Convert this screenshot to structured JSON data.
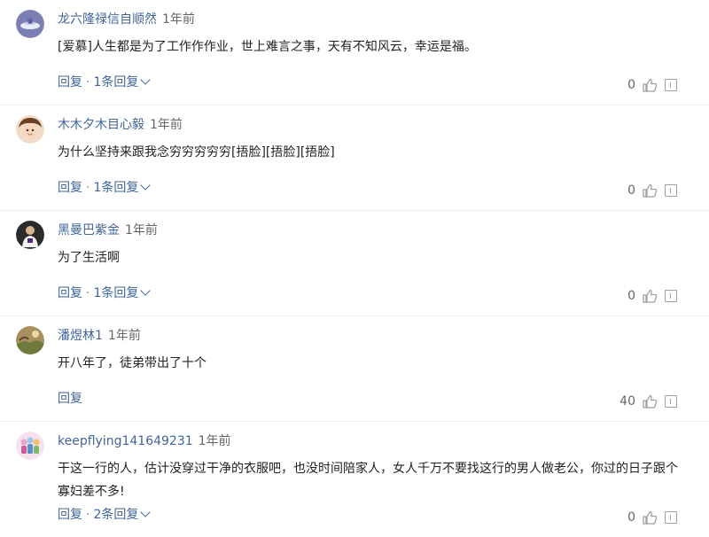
{
  "colors": {
    "name": "#406599",
    "action": "#406599",
    "text": "#222222",
    "muted": "#666666"
  },
  "comments": [
    {
      "name": "龙六隆禄信自顺然",
      "time": "1年前",
      "text": "[爱慕]人生都是为了工作作作业，世上难言之事，天有不知风云，幸运是福。",
      "reply_label": "回复",
      "sep": "·",
      "replies_label": "1条回复",
      "likes": "0",
      "avatar_icon": "ufo-avatar-icon"
    },
    {
      "name": "木木夕木目心毅",
      "time": "1年前",
      "text": "为什么坚持来跟我念穷穷穷穷穷[捂脸][捂脸][捂脸]",
      "reply_label": "回复",
      "sep": "·",
      "replies_label": "1条回复",
      "likes": "0",
      "avatar_icon": "child-avatar-icon"
    },
    {
      "name": "黑曼巴紫金",
      "time": "1年前",
      "text": "为了生活啊",
      "reply_label": "回复",
      "sep": "·",
      "replies_label": "1条回复",
      "likes": "0",
      "avatar_icon": "player-avatar-icon"
    },
    {
      "name": "潘煜林1",
      "time": "1年前",
      "text": "开八年了，徒弟带出了十个",
      "reply_label": "回复",
      "likes": "40",
      "avatar_icon": "landscape-avatar-icon"
    },
    {
      "name": "keepflying141649231",
      "time": "1年前",
      "text": "干这一行的人，估计没穿过干净的衣服吧，也没时间陪家人，女人千万不要找这行的男人做老公，你过的日子跟个寡妇差不多!",
      "reply_label": "回复",
      "sep": "·",
      "replies_label": "2条回复",
      "likes": "0",
      "avatar_icon": "dolls-avatar-icon"
    }
  ]
}
